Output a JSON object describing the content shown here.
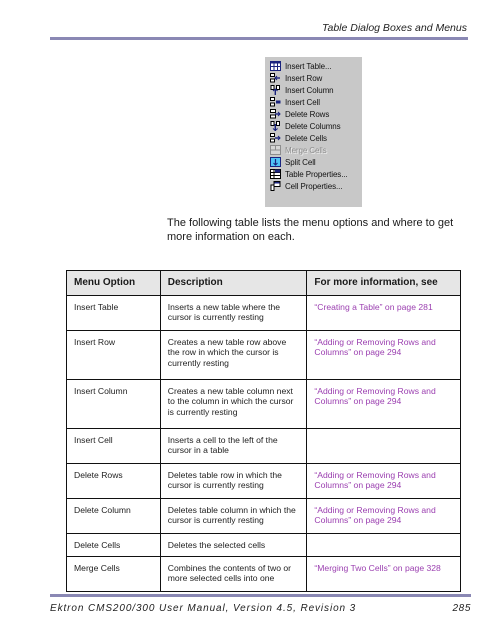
{
  "header": {
    "running_title": "Table Dialog Boxes and Menus"
  },
  "menu": {
    "items": [
      {
        "label": "Insert Table...",
        "icon": "insert-table-icon",
        "enabled": true
      },
      {
        "label": "Insert Row",
        "icon": "insert-row-icon",
        "enabled": true
      },
      {
        "label": "Insert Column",
        "icon": "insert-column-icon",
        "enabled": true
      },
      {
        "label": "Insert Cell",
        "icon": "insert-cell-icon",
        "enabled": true
      },
      {
        "label": "Delete Rows",
        "icon": "delete-rows-icon",
        "enabled": true
      },
      {
        "label": "Delete Columns",
        "icon": "delete-columns-icon",
        "enabled": true
      },
      {
        "label": "Delete Cells",
        "icon": "delete-cells-icon",
        "enabled": true
      },
      {
        "label": "Merge Cells",
        "icon": "merge-cells-icon",
        "enabled": false
      },
      {
        "label": "Split Cell",
        "icon": "split-cell-icon",
        "enabled": true
      },
      {
        "label": "Table Properties...",
        "icon": "table-properties-icon",
        "enabled": true
      },
      {
        "label": "Cell Properties...",
        "icon": "cell-properties-icon",
        "enabled": true
      }
    ]
  },
  "intro": "The following table lists the menu options and where to get more information on each.",
  "table": {
    "headers": [
      "Menu Option",
      "Description",
      "For more information, see"
    ],
    "rows": [
      {
        "option": "Insert Table",
        "description": "Inserts a new table where the cursor is currently resting",
        "see": "“Creating a Table” on page 281"
      },
      {
        "option": "Insert Row",
        "description": "Creates a new table row above the row in which the cursor is currently resting",
        "see": "“Adding or Removing Rows and Columns” on page 294"
      },
      {
        "option": "Insert Column",
        "description": "Creates a new table column next to the column in which the cursor is currently resting",
        "see": "“Adding or Removing Rows and Columns” on page 294"
      },
      {
        "option": "Insert Cell",
        "description": "Inserts a cell to the left of the cursor in a table",
        "see": ""
      },
      {
        "option": "Delete Rows",
        "description": "Deletes table row in which the cursor is currently resting",
        "see": "“Adding or Removing Rows and Columns” on page 294"
      },
      {
        "option": "Delete Column",
        "description": "Deletes table column in which the cursor is currently resting",
        "see": "“Adding or Removing Rows and Columns” on page 294"
      },
      {
        "option": "Delete Cells",
        "description": "Deletes the selected cells",
        "see": ""
      },
      {
        "option": "Merge Cells",
        "description": "Combines the contents of two or more selected cells into one",
        "see": "“Merging Two Cells” on page 328"
      }
    ]
  },
  "footer": {
    "manual_title": "Ektron CMS200/300 User Manual, Version 4.5, Revision 3",
    "page_number": "285"
  },
  "colors": {
    "rule": "#8a88b4",
    "xref_link": "#9b3fb0",
    "menu_background": "#c8c8c8",
    "table_header_background": "#e6e6e6"
  }
}
